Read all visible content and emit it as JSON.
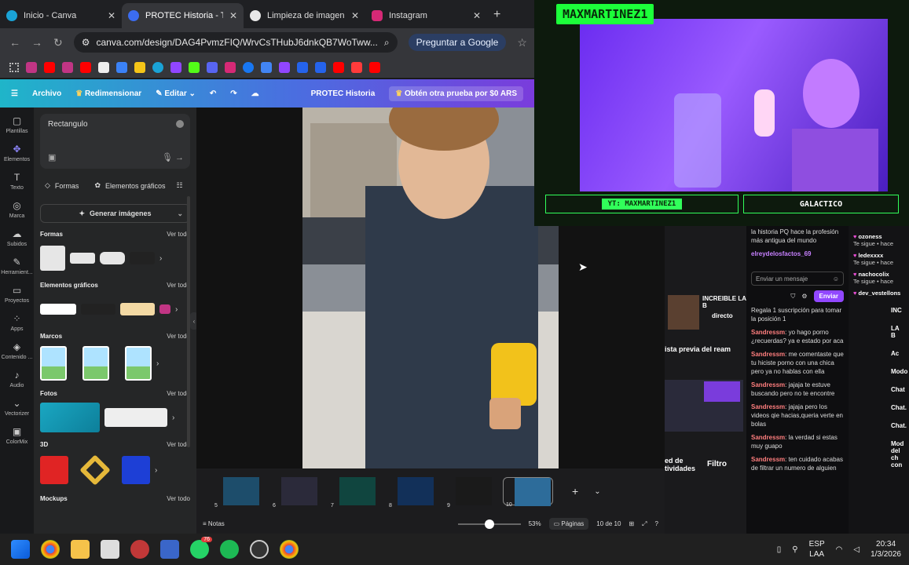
{
  "browser": {
    "tabs": [
      {
        "label": "Inicio - Canva",
        "color": "#1aa3d6",
        "active": false
      },
      {
        "label": "PROTEC Historia - Tu",
        "color": "#3b6cf0",
        "active": true
      },
      {
        "label": "Limpieza de imagen",
        "color": "#e8e8e8",
        "active": false
      },
      {
        "label": "Instagram",
        "color": "#d62976",
        "active": false
      }
    ],
    "url": "canva.com/design/DAG4PvmzFIQ/WrvCsTHubJ6dnkQB7WoTww...",
    "ask_google": "Preguntar a Google"
  },
  "canva": {
    "menu": {
      "file": "Archivo",
      "resize": "Redimensionar",
      "edit": "Editar",
      "project_title": "PROTEC Historia",
      "trial": "Obtén otra prueba por $0 ARS"
    },
    "rail": [
      {
        "icon": "▢",
        "label": "Plantillas"
      },
      {
        "icon": "✥",
        "label": "Elementos",
        "active": true
      },
      {
        "icon": "T",
        "label": "Texto"
      },
      {
        "icon": "◎",
        "label": "Marca"
      },
      {
        "icon": "☁",
        "label": "Subidos"
      },
      {
        "icon": "✎",
        "label": "Herramient..."
      },
      {
        "icon": "▭",
        "label": "Proyectos"
      },
      {
        "icon": "⁘",
        "label": "Apps"
      },
      {
        "icon": "◈",
        "label": "Contenido ..."
      },
      {
        "icon": "♪",
        "label": "Audio"
      },
      {
        "icon": "⌄",
        "label": "Vectorizer"
      },
      {
        "icon": "▣",
        "label": "ColorMix"
      }
    ],
    "panel": {
      "search_value": "Rectangulo",
      "chip_shapes": "Formas",
      "chip_graphics": "Elementos gráficos",
      "generate": "Generar imágenes",
      "see_all": "Ver todo",
      "sections": {
        "shapes": "Formas",
        "graphics": "Elementos gráficos",
        "frames": "Marcos",
        "photos": "Fotos",
        "three_d": "3D",
        "mockups": "Mockups"
      }
    },
    "filmstrip": {
      "pages": [
        "5",
        "6",
        "7",
        "8",
        "9",
        "10"
      ],
      "add": "+"
    },
    "status": {
      "notes": "Notas",
      "zoom": "53%",
      "pages_btn": "Páginas",
      "page_count": "10 de 10"
    }
  },
  "stream": {
    "streamer": "MAXMARTINEZ1",
    "tag_left": "YT: MAXMARTINEZ1",
    "tag_right": "GALACTICO"
  },
  "chat": {
    "top_messages": [
      {
        "text": "la historia PQ hace la profesión más antigua del mundo"
      },
      {
        "user": "elreydelosfactos_69",
        "text": ""
      }
    ],
    "input_placeholder": "Enviar un mensaje",
    "send": "Enviar",
    "gift_text": "Regala 1 suscripción para tomar la posición 1",
    "messages": [
      {
        "user": "Sandressm",
        "text": ": yo hago porno ¿recuerdas? ya e estado por aca"
      },
      {
        "user": "Sandressm",
        "text": ": me comentaste que tu hiciste porno con una chica pero ya no hablas con ella"
      },
      {
        "user": "Sandressm",
        "text": ": jajaja te estuve buscando pero no te encontre"
      },
      {
        "user": "Sandressm",
        "text": ": jajaja pero los videos qie hacias,queria verte en bolas"
      },
      {
        "user": "Sandressm",
        "text": ": la verdad si estas muy guapo"
      },
      {
        "user": "Sandressm",
        "text": ": ten cuidado acabas de filtrar un numero de alguien"
      }
    ]
  },
  "obs": {
    "label_incredible": "INCREIBLE LA B",
    "label_live": "directo",
    "preview": "ista previa del ream",
    "activity": "ed de tividades",
    "filter": "Filtro"
  },
  "activity": {
    "follows": [
      {
        "name": "ozoness",
        "status": "Te sigue • hace"
      },
      {
        "name": "ledexxxx",
        "status": "Te sigue • hace"
      },
      {
        "name": "nachocolix",
        "status": "Te sigue • hace"
      },
      {
        "name": "dev_vestellons",
        "status": ""
      }
    ],
    "side": [
      "INC",
      "LA B",
      "Ac",
      "Modo",
      "Chat",
      "Chat.",
      "Chat.",
      "Mod del ch con"
    ]
  },
  "taskbar": {
    "discord_badge": "76",
    "lang": "ESP",
    "lang2": "LAA",
    "time": "20:34",
    "date": "1/3/2026"
  }
}
